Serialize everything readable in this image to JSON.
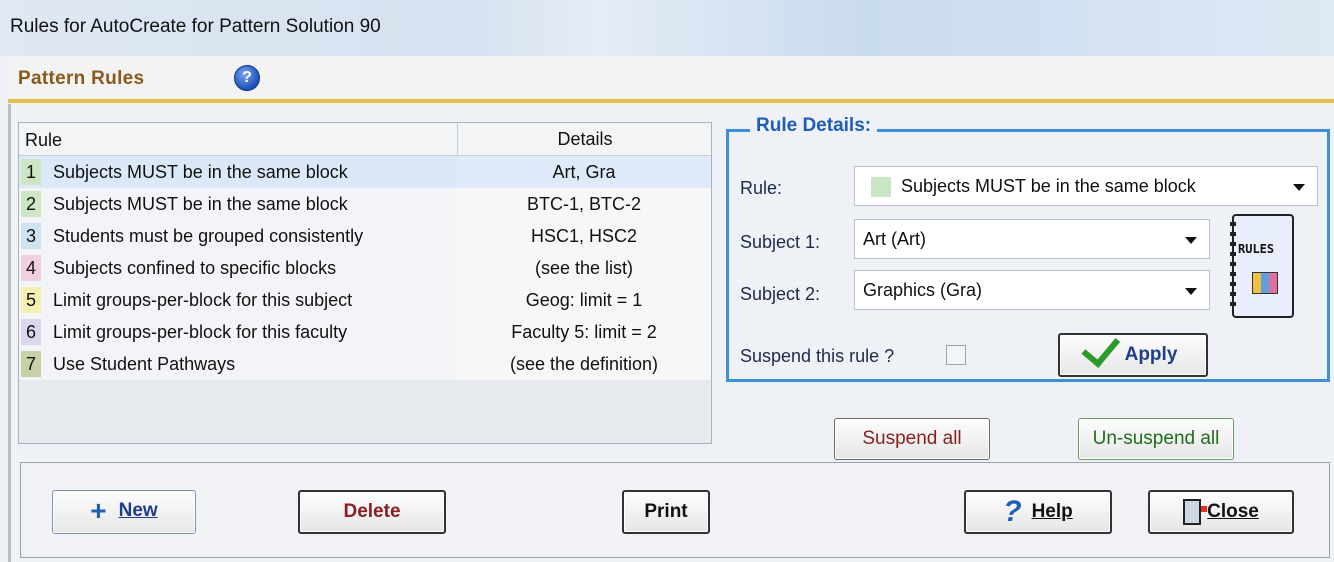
{
  "window": {
    "title": "Rules for AutoCreate for Pattern   Solution 90"
  },
  "header": {
    "title": "Pattern Rules",
    "help_icon": "question-circle-icon"
  },
  "rule_list": {
    "columns": [
      "Rule",
      "Details"
    ],
    "rows": [
      {
        "num": "1",
        "text": "Subjects MUST be in the same block",
        "details": "Art, Gra",
        "color": "#cde7c4"
      },
      {
        "num": "2",
        "text": "Subjects MUST be in the same block",
        "details": "BTC-1, BTC-2",
        "color": "#cde7c4"
      },
      {
        "num": "3",
        "text": "Students must be grouped consistently",
        "details": "HSC1, HSC2",
        "color": "#cfe3f3"
      },
      {
        "num": "4",
        "text": "Subjects confined to specific blocks",
        "details": "(see the list)",
        "color": "#f2cfe0"
      },
      {
        "num": "5",
        "text": "Limit groups-per-block for this subject",
        "details": "Geog:  limit = 1",
        "color": "#f6f0b2"
      },
      {
        "num": "6",
        "text": "Limit groups-per-block for this faculty",
        "details": "Faculty 5:  limit = 2",
        "color": "#dcd6ee"
      },
      {
        "num": "7",
        "text": "Use Student Pathways",
        "details": "(see the definition)",
        "color": "#c8d0a6"
      }
    ]
  },
  "rule_details": {
    "legend": "Rule Details:",
    "rule_label": "Rule:",
    "rule_value": "Subjects MUST be in the same block",
    "subject1_label": "Subject 1:",
    "subject1_value": "Art  (Art)",
    "subject2_label": "Subject 2:",
    "subject2_value": "Graphics  (Gra)",
    "suspend_label": "Suspend this rule ?",
    "apply_label": "Apply",
    "book_text": "RULES"
  },
  "actions": {
    "suspend_all": "Suspend all",
    "unsuspend_all": "Un-suspend all"
  },
  "footer": {
    "new_label": "New",
    "delete_label": "Delete",
    "print_label": "Print",
    "help_label": "Help",
    "close_label": "Close"
  }
}
